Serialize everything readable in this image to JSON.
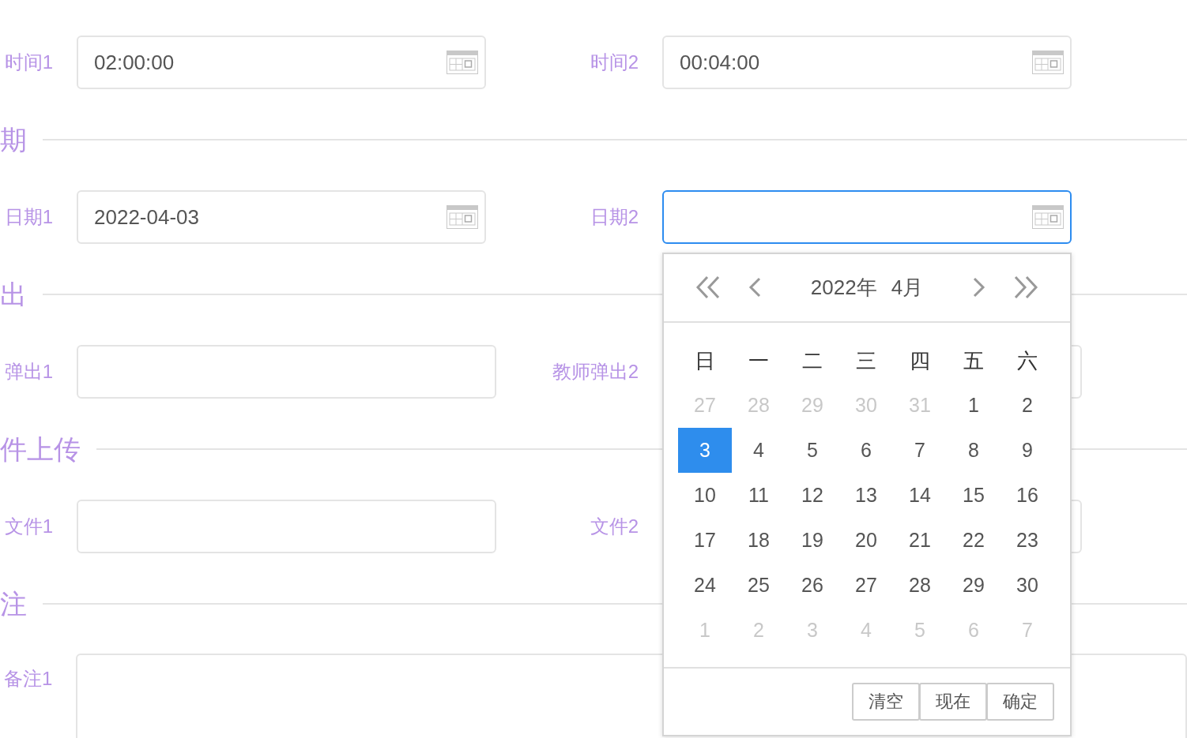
{
  "form": {
    "blocks": [
      {
        "kind": "row",
        "fields": [
          {
            "label": "时间1",
            "kind": "picker",
            "value": "02:00:00",
            "focused": false
          },
          {
            "label": "时间2",
            "kind": "picker",
            "value": "00:04:00",
            "focused": false
          }
        ]
      },
      {
        "kind": "heading",
        "title": "期"
      },
      {
        "kind": "row",
        "fields": [
          {
            "label": "日期1",
            "kind": "picker",
            "value": "2022-04-03",
            "focused": false
          },
          {
            "label": "日期2",
            "kind": "picker",
            "focused": true
          }
        ]
      },
      {
        "kind": "heading",
        "title": "出"
      },
      {
        "kind": "row",
        "fields": [
          {
            "label": "弹出1",
            "kind": "text",
            "focused": false
          },
          {
            "label": "教师弹出2",
            "kind": "text",
            "focused": false
          }
        ]
      },
      {
        "kind": "heading",
        "title": "件上传"
      },
      {
        "kind": "row",
        "fields": [
          {
            "label": "文件1",
            "kind": "text",
            "focused": false
          },
          {
            "label": "文件2",
            "kind": "text",
            "focused": false
          }
        ]
      },
      {
        "kind": "heading",
        "title": "注"
      },
      {
        "kind": "row",
        "fields": [
          {
            "label": "备注1",
            "kind": "textarea",
            "focused": false
          }
        ]
      }
    ]
  },
  "date_popup": {
    "year": "2022年",
    "month": "4月",
    "weekdays": [
      "日",
      "一",
      "二",
      "三",
      "四",
      "五",
      "六"
    ],
    "weeks": [
      [
        {
          "day": "27",
          "other_month": true,
          "selected": false
        },
        {
          "day": "28",
          "other_month": true,
          "selected": false
        },
        {
          "day": "29",
          "other_month": true,
          "selected": false
        },
        {
          "day": "30",
          "other_month": true,
          "selected": false
        },
        {
          "day": "31",
          "other_month": true,
          "selected": false
        },
        {
          "day": "1",
          "other_month": false,
          "selected": false
        },
        {
          "day": "2",
          "other_month": false,
          "selected": false
        }
      ],
      [
        {
          "day": "3",
          "other_month": false,
          "selected": true
        },
        {
          "day": "4",
          "other_month": false,
          "selected": false
        },
        {
          "day": "5",
          "other_month": false,
          "selected": false
        },
        {
          "day": "6",
          "other_month": false,
          "selected": false
        },
        {
          "day": "7",
          "other_month": false,
          "selected": false
        },
        {
          "day": "8",
          "other_month": false,
          "selected": false
        },
        {
          "day": "9",
          "other_month": false,
          "selected": false
        }
      ],
      [
        {
          "day": "10",
          "other_month": false,
          "selected": false
        },
        {
          "day": "11",
          "other_month": false,
          "selected": false
        },
        {
          "day": "12",
          "other_month": false,
          "selected": false
        },
        {
          "day": "13",
          "other_month": false,
          "selected": false
        },
        {
          "day": "14",
          "other_month": false,
          "selected": false
        },
        {
          "day": "15",
          "other_month": false,
          "selected": false
        },
        {
          "day": "16",
          "other_month": false,
          "selected": false
        }
      ],
      [
        {
          "day": "17",
          "other_month": false,
          "selected": false
        },
        {
          "day": "18",
          "other_month": false,
          "selected": false
        },
        {
          "day": "19",
          "other_month": false,
          "selected": false
        },
        {
          "day": "20",
          "other_month": false,
          "selected": false
        },
        {
          "day": "21",
          "other_month": false,
          "selected": false
        },
        {
          "day": "22",
          "other_month": false,
          "selected": false
        },
        {
          "day": "23",
          "other_month": false,
          "selected": false
        }
      ],
      [
        {
          "day": "24",
          "other_month": false,
          "selected": false
        },
        {
          "day": "25",
          "other_month": false,
          "selected": false
        },
        {
          "day": "26",
          "other_month": false,
          "selected": false
        },
        {
          "day": "27",
          "other_month": false,
          "selected": false
        },
        {
          "day": "28",
          "other_month": false,
          "selected": false
        },
        {
          "day": "29",
          "other_month": false,
          "selected": false
        },
        {
          "day": "30",
          "other_month": false,
          "selected": false
        }
      ],
      [
        {
          "day": "1",
          "other_month": true,
          "selected": false
        },
        {
          "day": "2",
          "other_month": true,
          "selected": false
        },
        {
          "day": "3",
          "other_month": true,
          "selected": false
        },
        {
          "day": "4",
          "other_month": true,
          "selected": false
        },
        {
          "day": "5",
          "other_month": true,
          "selected": false
        },
        {
          "day": "6",
          "other_month": true,
          "selected": false
        },
        {
          "day": "7",
          "other_month": true,
          "selected": false
        }
      ]
    ],
    "buttons": [
      "清空",
      "现在",
      "确定"
    ]
  }
}
